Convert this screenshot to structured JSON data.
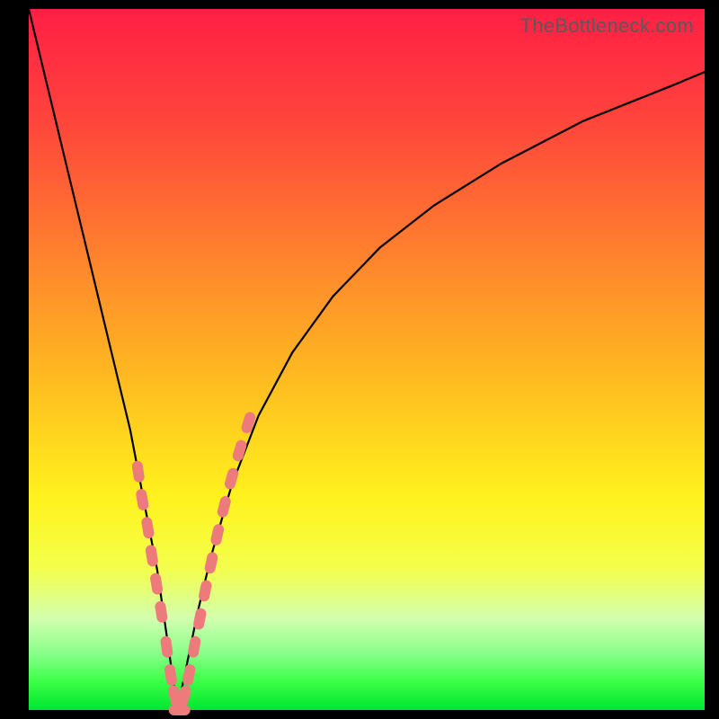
{
  "watermark": "TheBottleneck.com",
  "colors": {
    "gradient_top": "#ff1f45",
    "gradient_bottom": "#00e62f",
    "curve": "#000000",
    "marker": "#ed7b7b",
    "frame": "#000000"
  },
  "chart_data": {
    "type": "line",
    "title": "",
    "xlabel": "",
    "ylabel": "",
    "xlim": [
      0,
      100
    ],
    "ylim": [
      0,
      100
    ],
    "x_min_at": 22,
    "series": [
      {
        "name": "bottleneck-curve",
        "x": [
          0,
          3,
          6,
          9,
          12,
          15,
          17,
          19,
          20.5,
          22,
          23.5,
          25,
          27,
          30,
          34,
          39,
          45,
          52,
          60,
          70,
          82,
          95,
          100
        ],
        "y": [
          100,
          88,
          76,
          64,
          52,
          40,
          30,
          20,
          10,
          0,
          7,
          14,
          22,
          32,
          42,
          51,
          59,
          66,
          72,
          78,
          84,
          89,
          91
        ]
      }
    ],
    "markers": {
      "name": "highlighted-points",
      "x": [
        16.2,
        16.8,
        17.6,
        18.2,
        18.9,
        19.6,
        20.4,
        21.0,
        21.6,
        22.3,
        23.0,
        23.7,
        24.5,
        25.3,
        26.1,
        27.0,
        27.9,
        28.9,
        30.0,
        31.2,
        32.5
      ],
      "y": [
        34,
        30,
        26,
        22,
        18,
        14,
        9,
        5,
        2,
        0,
        2,
        5,
        9,
        13,
        17,
        21,
        25,
        29,
        33,
        37,
        41
      ]
    }
  }
}
